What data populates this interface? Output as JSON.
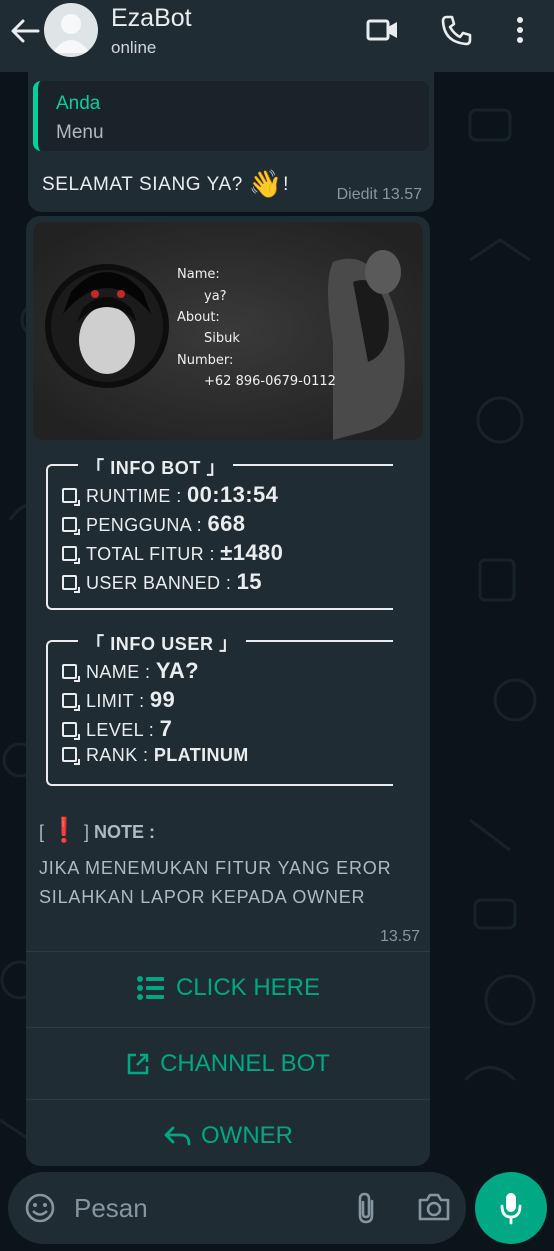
{
  "header": {
    "contact_name": "EzaBot",
    "status": "online",
    "icons": [
      "back-arrow-icon",
      "avatar",
      "video-call-icon",
      "phone-call-icon",
      "more-options-icon"
    ]
  },
  "message1": {
    "quote_author": "Anda",
    "quote_text": "Menu",
    "text": "SELAMAT SIANG YA?",
    "emoji": "👋",
    "suffix": "!",
    "meta": "Diedit 13.57"
  },
  "message2": {
    "banner": {
      "name_label": "Name:",
      "name_value": "ya?",
      "about_label": "About:",
      "about_value": "Sibuk",
      "number_label": "Number:",
      "number_value": "+62 896-0679-0112"
    },
    "info_bot": {
      "title": "「 INFO BOT 」",
      "rows": [
        {
          "label": "RUNTIME : ",
          "value": "00:13:54"
        },
        {
          "label": "PENGGUNA : ",
          "value": "668"
        },
        {
          "label": "TOTAL FITUR : ",
          "value": "±1480"
        },
        {
          "label": "USER BANNED : ",
          "value": "15"
        }
      ]
    },
    "info_user": {
      "title": "「 INFO USER 」",
      "rows": [
        {
          "label": "NAME : ",
          "value": "YA?"
        },
        {
          "label": "LIMIT : ",
          "value": "99"
        },
        {
          "label": "LEVEL : ",
          "value": "7"
        },
        {
          "label": "RANK : ",
          "value": "PLATINUM"
        }
      ]
    },
    "note": {
      "open": "[",
      "mark": "❗",
      "close": "]",
      "label": "NOTE :",
      "line1": "JIKA MENEMUKAN FITUR YANG EROR",
      "line2": "SILAHKAN LAPOR KEPADA OWNER"
    },
    "time": "13.57",
    "buttons": [
      {
        "label": "CLICK HERE",
        "icon": "list-icon"
      },
      {
        "label": "CHANNEL BOT",
        "icon": "external-link-icon"
      },
      {
        "label": "OWNER",
        "icon": "reply-icon"
      }
    ]
  },
  "input": {
    "placeholder": "Pesan",
    "icons": [
      "emoji-icon",
      "attach-icon",
      "camera-icon",
      "mic-icon"
    ]
  },
  "colors": {
    "accent": "#00a884",
    "header_bg": "#1f2c34",
    "chat_bg": "#0b141a",
    "bubble_bg": "#1f2c34"
  }
}
